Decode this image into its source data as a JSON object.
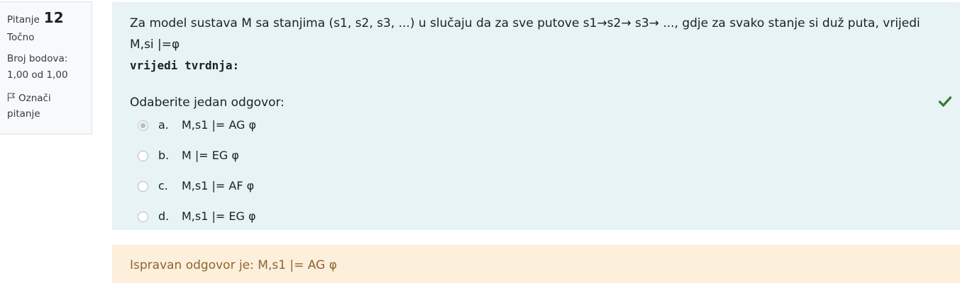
{
  "info": {
    "question_label": "Pitanje",
    "question_number": "12",
    "state": "Točno",
    "grade_label": "Broj bodova:",
    "grade_value": "1,00 od 1,00",
    "flag_label": "Označi pitanje",
    "flag_icon": "flag-icon"
  },
  "question": {
    "text": "Za model sustava M sa stanjima (s1, s2, s3, ...) u slučaju da za sve putove s1→s2→ s3→ ..., gdje za svako stanje si duž puta, vrijedi M,si |=φ",
    "text_bold": "vrijedi tvrdnja:",
    "prompt": "Odaberite jedan odgovor:",
    "answers": [
      {
        "letter": "a.",
        "text": "M,s1 |= AG φ",
        "selected": true
      },
      {
        "letter": "b.",
        "text": "M |= EG φ",
        "selected": false
      },
      {
        "letter": "c.",
        "text": "M,s1 |= AF φ",
        "selected": false
      },
      {
        "letter": "d.",
        "text": "M,s1 |= EG φ",
        "selected": false
      }
    ],
    "correct_icon": "check-icon",
    "correct_color": "#357a32"
  },
  "outcome": {
    "text": "Ispravan odgovor je: M,s1 |= AG φ"
  },
  "colors": {
    "formulation_bg": "#e7f3f5",
    "outcome_bg": "#fcefdc",
    "outcome_text": "#8e662e",
    "info_bg": "#f8f9fa"
  }
}
